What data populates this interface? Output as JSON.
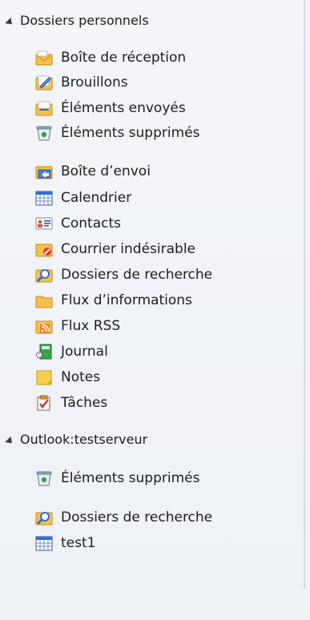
{
  "folders": {
    "personal": {
      "header": "Dossiers personnels",
      "items": [
        {
          "label": "Boîte de réception",
          "icon": "inbox-icon"
        },
        {
          "label": "Brouillons",
          "icon": "drafts-icon"
        },
        {
          "label": "Éléments envoyés",
          "icon": "sent-items-icon"
        },
        {
          "label": "Éléments supprimés",
          "icon": "deleted-items-icon"
        },
        {
          "label": "Boîte d’envoi",
          "icon": "outbox-icon"
        },
        {
          "label": "Calendrier",
          "icon": "calendar-icon"
        },
        {
          "label": "Contacts",
          "icon": "contacts-icon"
        },
        {
          "label": "Courrier indésirable",
          "icon": "junk-mail-icon"
        },
        {
          "label": "Dossiers de recherche",
          "icon": "search-folder-icon"
        },
        {
          "label": "Flux d’informations",
          "icon": "folder-icon"
        },
        {
          "label": "Flux RSS",
          "icon": "rss-icon"
        },
        {
          "label": "Journal",
          "icon": "journal-icon"
        },
        {
          "label": "Notes",
          "icon": "notes-icon"
        },
        {
          "label": "Tâches",
          "icon": "tasks-icon"
        }
      ]
    },
    "server": {
      "header": "Outlook:testserveur",
      "items": [
        {
          "label": "Éléments supprimés",
          "icon": "deleted-items-icon"
        },
        {
          "label": "Dossiers de recherche",
          "icon": "search-folder-icon"
        },
        {
          "label": "test1",
          "icon": "calendar-icon"
        }
      ]
    }
  }
}
